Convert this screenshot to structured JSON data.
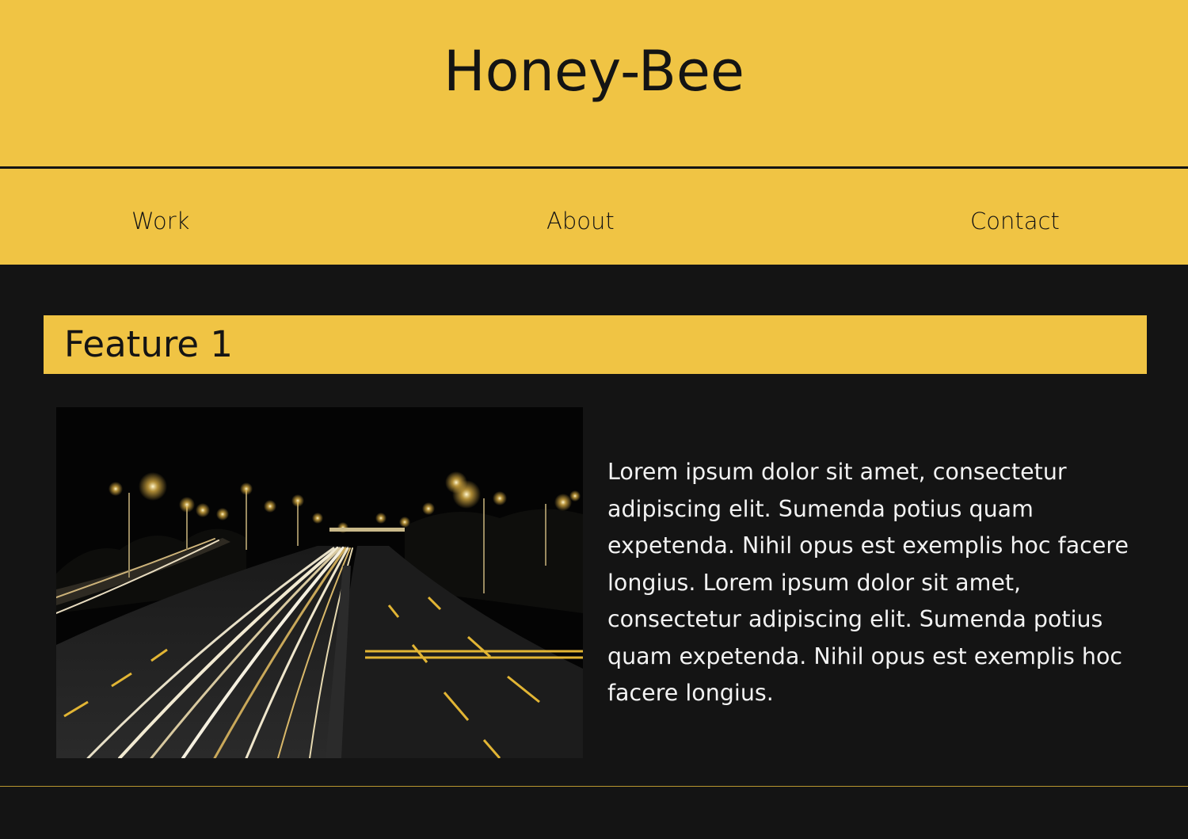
{
  "site": {
    "title": "Honey-Bee"
  },
  "nav": {
    "items": [
      {
        "label": "Work"
      },
      {
        "label": "About"
      },
      {
        "label": "Contact"
      }
    ]
  },
  "feature": {
    "title": "Feature 1",
    "image_alt": "Night highway with light trails",
    "body": "Lorem ipsum dolor sit amet, consectetur adipiscing elit. Sumenda potius quam expetenda. Nihil opus est exemplis hoc facere longius. Lorem ipsum dolor sit amet, consectetur adipiscing elit. Sumenda potius quam expetenda. Nihil opus est exemplis hoc facere longius."
  },
  "colors": {
    "accent": "#f0c444",
    "background": "#141414",
    "text_dark": "#141414",
    "text_light": "#f2f2f2"
  }
}
